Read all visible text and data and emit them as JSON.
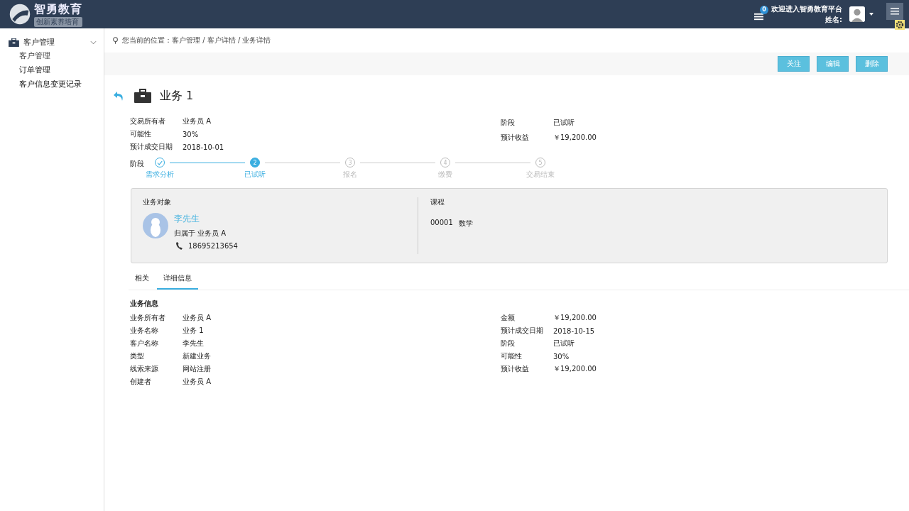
{
  "header": {
    "logo_title": "智勇教育",
    "logo_subtitle": "创新素养培育",
    "notification_count": "0",
    "welcome": "欢迎进入智勇教育平台",
    "user_label": "姓名:"
  },
  "sidebar": {
    "group": {
      "label": "客户管理",
      "expanded": true
    },
    "items": [
      {
        "label": "客户管理",
        "selected": true
      },
      {
        "label": "订单管理",
        "selected": false
      },
      {
        "label": "客户信息变更记录",
        "selected": false
      }
    ]
  },
  "breadcrumb": "您当前的位置：客户管理 / 客户详情 / 业务详情",
  "actions": [
    "关注",
    "编辑",
    "删除"
  ],
  "title": "业务 1",
  "summary_left": [
    {
      "label": "交易所有者",
      "value": "业务员 A"
    },
    {
      "label": "可能性",
      "value": "30%"
    },
    {
      "label": "预计成交日期",
      "value": "2018-10-01"
    }
  ],
  "summary_right": [
    {
      "label": "阶段",
      "value": "已试听"
    },
    {
      "label": "预计收益",
      "value": "￥19,200.00"
    }
  ],
  "stage_label": "阶段",
  "steps": [
    {
      "label": "需求分析",
      "kind": "done"
    },
    {
      "number": "2",
      "label": "已试听",
      "kind": "current"
    },
    {
      "number": "3",
      "label": "报名",
      "kind": "pending"
    },
    {
      "number": "4",
      "label": "缴费",
      "kind": "pending"
    },
    {
      "number": "5",
      "label": "交易结束",
      "kind": "pending"
    }
  ],
  "target": {
    "heading": "业务对象",
    "name": "李先生",
    "owner": "归属于 业务员 A",
    "phone": "18695213654"
  },
  "course": {
    "heading": "课程",
    "code": "00001",
    "name": "数学"
  },
  "tabs": [
    {
      "label": "相关",
      "selected": false
    },
    {
      "label": "详细信息",
      "selected": true
    }
  ],
  "info_heading": "业务信息",
  "info_left": [
    {
      "label": "业务所有者",
      "value": "业务员 A"
    },
    {
      "label": "业务名称",
      "value": "业务 1"
    },
    {
      "label": "客户名称",
      "value": "李先生"
    },
    {
      "label": "类型",
      "value": "新建业务"
    },
    {
      "label": "线索来源",
      "value": "网站注册"
    },
    {
      "label": "创建者",
      "value": "业务员 A"
    }
  ],
  "info_right": [
    {
      "label": "金额",
      "value": "￥19,200.00"
    },
    {
      "label": "预计成交日期",
      "value": "2018-10-15"
    },
    {
      "label": "阶段",
      "value": "已试听"
    },
    {
      "label": "可能性",
      "value": "30%"
    },
    {
      "label": "预计收益",
      "value": "￥19,200.00"
    }
  ]
}
